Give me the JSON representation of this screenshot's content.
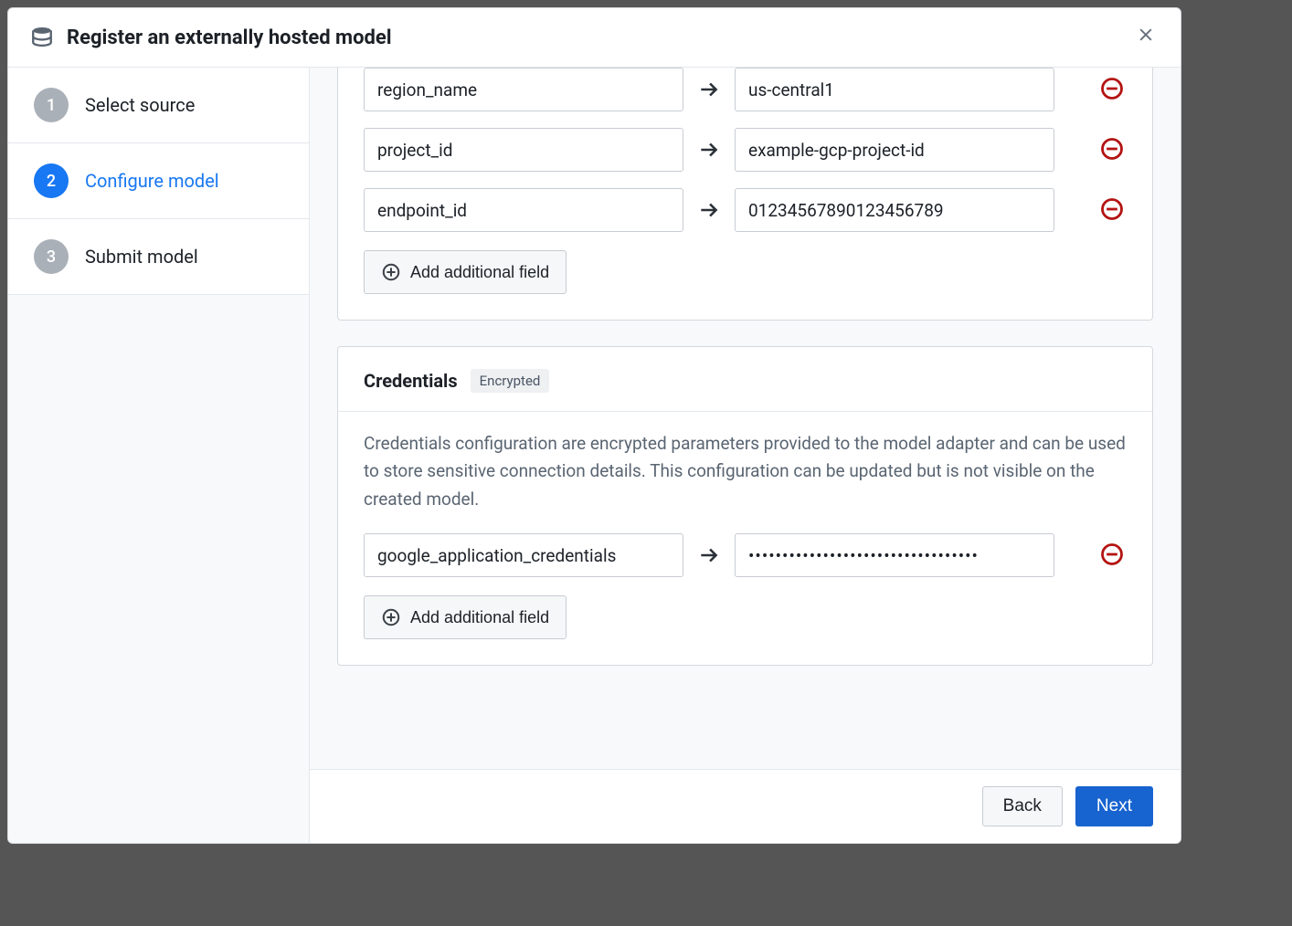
{
  "header": {
    "title": "Register an externally hosted model"
  },
  "stepper": {
    "steps": [
      {
        "num": "1",
        "label": "Select source",
        "active": false
      },
      {
        "num": "2",
        "label": "Configure model",
        "active": true
      },
      {
        "num": "3",
        "label": "Submit model",
        "active": false
      }
    ]
  },
  "config_fields": [
    {
      "key": "region_name",
      "value": "us-central1"
    },
    {
      "key": "project_id",
      "value": "example-gcp-project-id"
    },
    {
      "key": "endpoint_id",
      "value": "01234567890123456789"
    }
  ],
  "add_field_label": "Add additional field",
  "credentials": {
    "title": "Credentials",
    "badge": "Encrypted",
    "description": "Credentials configuration are encrypted parameters provided to the model adapter and can be used to store sensitive connection details. This configuration can be updated but is not visible on the created model.",
    "fields": [
      {
        "key": "google_application_credentials",
        "value": "••••••••••••••••••••••••••••••••••"
      }
    ]
  },
  "footer": {
    "back": "Back",
    "next": "Next"
  }
}
